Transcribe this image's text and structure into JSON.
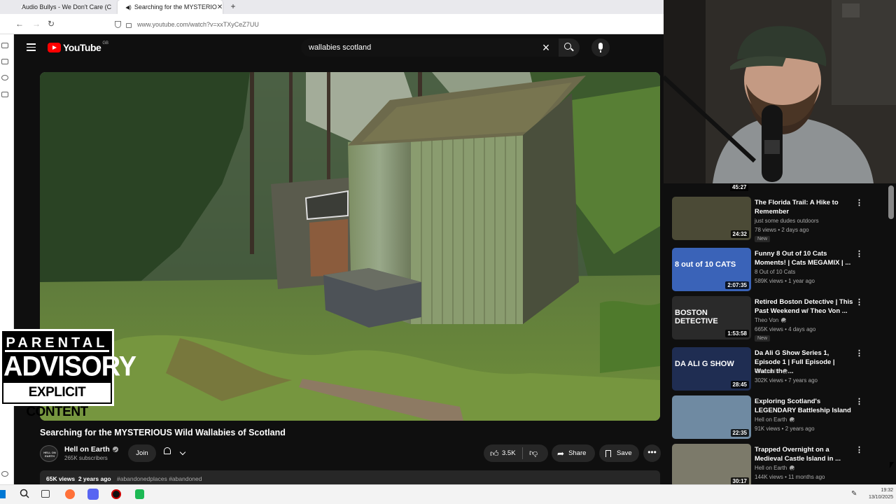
{
  "browser": {
    "tabs": [
      {
        "label": "Audio Bullys - We Don't Care (C",
        "active": false
      },
      {
        "label": "Searching for the MYSTERIO",
        "active": true
      }
    ],
    "url": "www.youtube.com/watch?v=xxTXyCeZ7UU"
  },
  "youtube": {
    "logo_text": "YouTube",
    "region": "GB",
    "search_value": "wallabies scotland"
  },
  "video": {
    "title": "Searching for the MYSTERIOUS Wild Wallabies of Scotland",
    "channel": "Hell on Earth",
    "channel_avatar_text": "HELL ON EARTH",
    "subscribers": "265K subscribers",
    "join_label": "Join",
    "likes": "3.5K",
    "share_label": "Share",
    "save_label": "Save",
    "views_age": "65K views  2 years ago",
    "tags": "#abandonedplaces #abandoned"
  },
  "overlay": {
    "line1": "PARENTAL",
    "line2": "ADVISORY",
    "line3": "EXPLICIT CONTENT"
  },
  "top_partial_duration": "45:27",
  "recommendations": [
    {
      "title": "The Florida Trail: A Hike to Remember",
      "channel": "just some dudes outdoors",
      "verified": false,
      "meta": "78 views • 2 days ago",
      "badge": "New",
      "duration": "24:32",
      "thumb_color": "#4b4a36"
    },
    {
      "title": "Funny 8 Out of 10 Cats Moments! | Cats MEGAMIX | ...",
      "channel": "8 Out of 10 Cats",
      "verified": false,
      "meta": "589K views • 1 year ago",
      "badge": "",
      "duration": "2:07:35",
      "thumb_color": "#3a63b8",
      "thumb_text": "8 out of 10 CATS"
    },
    {
      "title": "Retired Boston Detective | This Past Weekend w/ Theo Von ...",
      "channel": "Theo Von",
      "verified": true,
      "meta": "665K views • 4 days ago",
      "badge": "New",
      "duration": "1:53:58",
      "thumb_color": "#2a2a2a",
      "thumb_text": "BOSTON DETECTIVE"
    },
    {
      "title": "Da Ali G Show Series 1, Episode 1 | Full Episode | Watch the ...",
      "channel": "Channel 4",
      "verified": true,
      "meta": "302K views • 7 years ago",
      "badge": "",
      "duration": "28:45",
      "thumb_color": "#1f2d52",
      "thumb_text": "DA ALI G SHOW"
    },
    {
      "title": "Exploring Scotland's LEGENDARY Battleship Island",
      "channel": "Hell on Earth",
      "verified": true,
      "meta": "91K views • 2 years ago",
      "badge": "",
      "duration": "22:35",
      "thumb_color": "#6f8aa2"
    },
    {
      "title": "Trapped Overnight on a Medieval Castle Island in ...",
      "channel": "Hell on Earth",
      "verified": true,
      "meta": "144K views • 11 months ago",
      "badge": "",
      "duration": "30:17",
      "thumb_color": "#7c7a6a"
    }
  ],
  "taskbar": {
    "time": "19:32",
    "date": "13/10/2025"
  }
}
